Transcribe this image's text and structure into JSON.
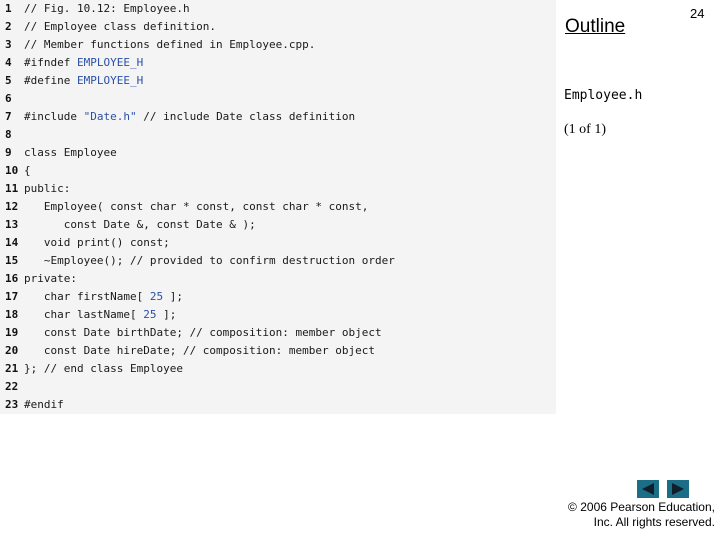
{
  "code": {
    "lines": [
      {
        "n": "1",
        "parts": [
          {
            "t": "// Fig. 10.12: Employee.h",
            "c": "cm"
          }
        ]
      },
      {
        "n": "2",
        "parts": [
          {
            "t": "// Employee class definition.",
            "c": "cm"
          }
        ]
      },
      {
        "n": "3",
        "parts": [
          {
            "t": "// Member functions defined in Employee.cpp.",
            "c": "cm"
          }
        ]
      },
      {
        "n": "4",
        "parts": [
          {
            "t": "#ifndef ",
            "c": "pp"
          },
          {
            "t": "EMPLOYEE_H",
            "c": "macro"
          }
        ]
      },
      {
        "n": "5",
        "parts": [
          {
            "t": "#define ",
            "c": "pp"
          },
          {
            "t": "EMPLOYEE_H",
            "c": "macro"
          }
        ]
      },
      {
        "n": "6",
        "parts": []
      },
      {
        "n": "7",
        "parts": [
          {
            "t": "#include ",
            "c": "pp"
          },
          {
            "t": "\"Date.h\"",
            "c": "str"
          },
          {
            "t": " // include Date class definition",
            "c": "cm"
          }
        ]
      },
      {
        "n": "8",
        "parts": []
      },
      {
        "n": "9",
        "parts": [
          {
            "t": "class Employee",
            "c": "kw"
          }
        ]
      },
      {
        "n": "10",
        "parts": [
          {
            "t": "{",
            "c": "kw"
          }
        ]
      },
      {
        "n": "11",
        "parts": [
          {
            "t": "public:",
            "c": "kw"
          }
        ]
      },
      {
        "n": "12",
        "parts": [
          {
            "t": "   Employee( const char * const, const char * const,",
            "c": "kw"
          }
        ]
      },
      {
        "n": "13",
        "parts": [
          {
            "t": "      const Date &, const Date & );",
            "c": "kw"
          }
        ]
      },
      {
        "n": "14",
        "parts": [
          {
            "t": "   void print() const;",
            "c": "kw"
          }
        ]
      },
      {
        "n": "15",
        "parts": [
          {
            "t": "   ~Employee(); // provided to confirm destruction order",
            "c": "kw"
          }
        ]
      },
      {
        "n": "16",
        "parts": [
          {
            "t": "private:",
            "c": "kw"
          }
        ]
      },
      {
        "n": "17",
        "parts": [
          {
            "t": "   char firstName[ ",
            "c": "kw"
          },
          {
            "t": "25",
            "c": "num"
          },
          {
            "t": " ];",
            "c": "kw"
          }
        ]
      },
      {
        "n": "18",
        "parts": [
          {
            "t": "   char lastName[ ",
            "c": "kw"
          },
          {
            "t": "25",
            "c": "num"
          },
          {
            "t": " ];",
            "c": "kw"
          }
        ]
      },
      {
        "n": "19",
        "parts": [
          {
            "t": "   const Date birthDate; // composition: member object",
            "c": "kw"
          }
        ]
      },
      {
        "n": "20",
        "parts": [
          {
            "t": "   const Date hireDate; // composition: member object",
            "c": "kw"
          }
        ]
      },
      {
        "n": "21",
        "parts": [
          {
            "t": "}; // end class Employee",
            "c": "kw"
          }
        ]
      },
      {
        "n": "22",
        "parts": []
      },
      {
        "n": "23",
        "parts": [
          {
            "t": "#endif",
            "c": "pp"
          }
        ]
      }
    ]
  },
  "sidebar": {
    "outline_label": "Outline",
    "page_number": "24",
    "filename": "Employee.h",
    "page_count": "(1 of 1)"
  },
  "nav": {
    "prev_icon": "triangle-left-icon",
    "next_icon": "triangle-right-icon",
    "button_color": "#1c6e86"
  },
  "footer": {
    "copyright_line1": "© 2006 Pearson Education,",
    "copyright_line2": "Inc.  All rights reserved."
  }
}
